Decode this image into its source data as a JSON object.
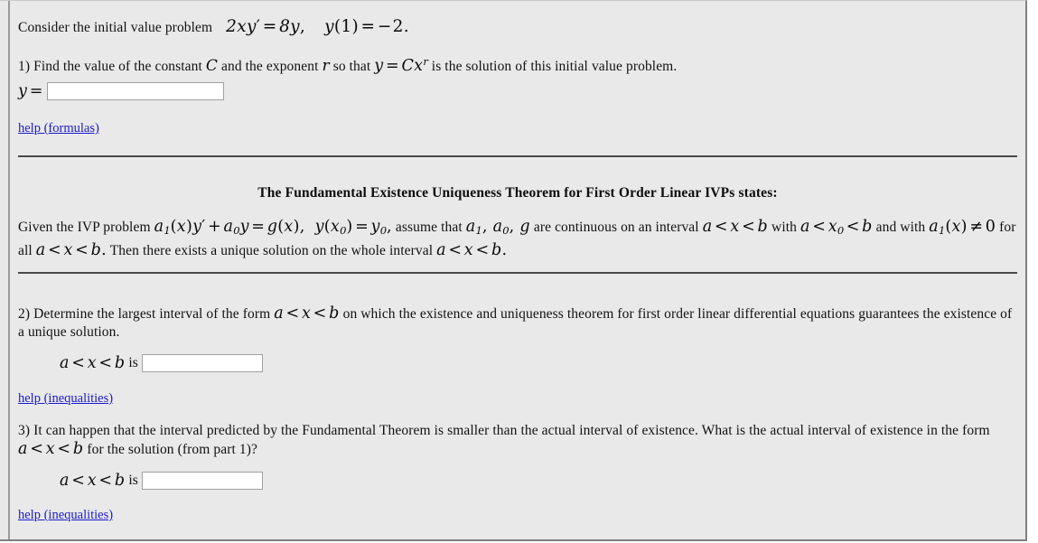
{
  "problem": {
    "intro_text": "Consider the initial value problem",
    "intro_math_ode": "2xy' = 8y,",
    "intro_math_ic": "y(1) = -2."
  },
  "q1": {
    "number": "1)",
    "text_a": "Find the value of the constant",
    "math_C": "C",
    "text_b": "and the exponent",
    "math_r": "r",
    "text_c": "so that",
    "math_sol": "y = Cx^r",
    "text_d": "is the solution of this initial value problem.",
    "answer_label": "y =",
    "answer_value": "",
    "answer_placeholder": "",
    "help_label": "help (formulas)"
  },
  "theorem": {
    "title": "The Fundamental Existence Uniqueness Theorem for First Order Linear IVPs states:",
    "line1_t1": "Given the IVP problem",
    "line1_math1": "a_1(x)y' + a_0 y = g(x),",
    "line1_math2": "y(x_0) = y_0,",
    "line1_t2": "assume that",
    "line1_math3": "a_1, a_0, g",
    "line1_t3": "are continuous on an interval",
    "line1_math4": "a < x < b",
    "line1_t4": "with",
    "line1_math5": "a < x_0 < b",
    "line1_t5": "and with",
    "line2_math1": "a_1(x) ≠ 0",
    "line2_t1": "for all",
    "line2_math2": "a < x < b.",
    "line2_t2": "Then there exists a unique solution on the whole interval",
    "line2_math3": "a < x < b."
  },
  "q2": {
    "number": "2)",
    "text_a": "Determine the largest interval of the form",
    "math_interval": "a < x < b",
    "text_b": "on which the existence and uniqueness theorem for first order linear differential equations guarantees the existence of a unique solution.",
    "answer_label_math": "a < x < b",
    "answer_label_is": "is",
    "answer_value": "",
    "answer_placeholder": "",
    "help_label": "help (inequalities)"
  },
  "q3": {
    "number": "3)",
    "text_a": "It can happen that the interval predicted by the Fundamental Theorem is smaller than the actual interval of existence. What is the actual interval of existence in the form",
    "math_interval": "a < x < b",
    "text_b": "for the solution (from part 1)?",
    "answer_label_math": "a < x < b",
    "answer_label_is": "is",
    "answer_value": "",
    "answer_placeholder": "",
    "help_label": "help (inequalities)"
  },
  "colors": {
    "page_background": "#e9e9e9",
    "link": "#1a1ad0",
    "text": "#111111",
    "divider": "#4a4a4a",
    "input_border": "#a0a0a0",
    "input_background": "#ffffff"
  }
}
